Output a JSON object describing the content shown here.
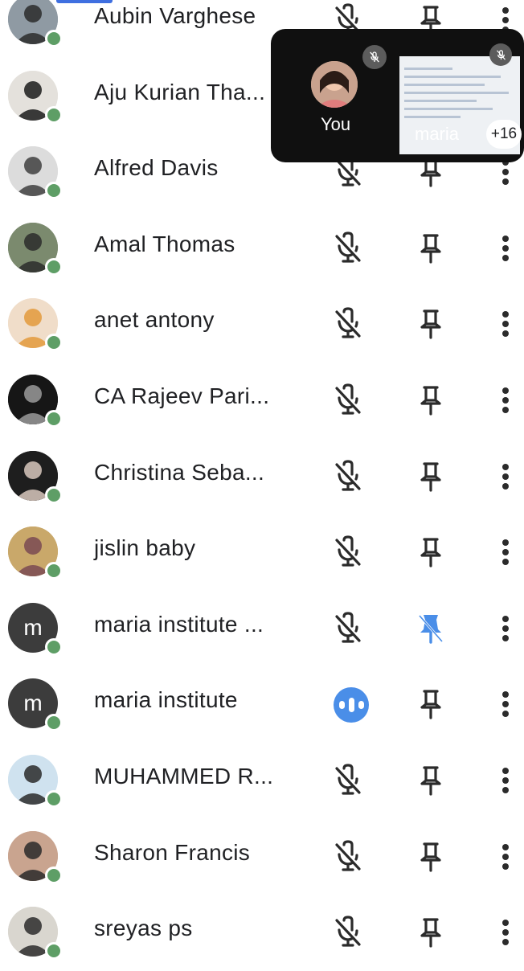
{
  "participants": [
    {
      "name": "Aubin Varghese",
      "mic": "muted",
      "pinned": false,
      "avatar": {
        "type": "photo",
        "bg": "#8f9aa3",
        "fg": "#2b2b2b"
      }
    },
    {
      "name": "Aju Kurian Tha...",
      "mic": "muted",
      "pinned": false,
      "avatar": {
        "type": "photo",
        "bg": "#e4e1dc",
        "fg": "#1b1b1b"
      }
    },
    {
      "name": "Alfred Davis",
      "mic": "muted",
      "pinned": false,
      "avatar": {
        "type": "photo",
        "bg": "#dcdcdc",
        "fg": "#404040"
      }
    },
    {
      "name": "Amal Thomas",
      "mic": "muted",
      "pinned": false,
      "avatar": {
        "type": "photo",
        "bg": "#7b8a6e",
        "fg": "#2b2b2b"
      }
    },
    {
      "name": "anet antony",
      "mic": "muted",
      "pinned": false,
      "avatar": {
        "type": "photo",
        "bg": "#f0ddc9",
        "fg": "#e39a3c"
      }
    },
    {
      "name": "CA Rajeev Pari...",
      "mic": "muted",
      "pinned": false,
      "avatar": {
        "type": "photo",
        "bg": "#161616",
        "fg": "#9a9a9a"
      }
    },
    {
      "name": "Christina Seba...",
      "mic": "muted",
      "pinned": false,
      "avatar": {
        "type": "photo",
        "bg": "#1e1e1e",
        "fg": "#d8c8bd"
      }
    },
    {
      "name": "jislin baby",
      "mic": "muted",
      "pinned": false,
      "avatar": {
        "type": "photo",
        "bg": "#c9a86a",
        "fg": "#7a4a52"
      }
    },
    {
      "name": "maria institute ...",
      "mic": "muted",
      "pinned": true,
      "avatar": {
        "type": "letter",
        "letter": "m",
        "bg": "#3c3c3c"
      }
    },
    {
      "name": "maria institute",
      "mic": "speaking",
      "pinned": false,
      "avatar": {
        "type": "letter",
        "letter": "m",
        "bg": "#3c3c3c"
      }
    },
    {
      "name": "MUHAMMED R...",
      "mic": "muted",
      "pinned": false,
      "avatar": {
        "type": "photo",
        "bg": "#cfe2ef",
        "fg": "#2a2a2a"
      }
    },
    {
      "name": "Sharon Francis",
      "mic": "muted",
      "pinned": false,
      "avatar": {
        "type": "photo",
        "bg": "#c9a48f",
        "fg": "#2a2a2a"
      }
    },
    {
      "name": "sreyas ps",
      "mic": "muted",
      "pinned": false,
      "avatar": {
        "type": "photo",
        "bg": "#d9d6cf",
        "fg": "#2b2b2b"
      }
    }
  ],
  "overlay": {
    "self_label": "You",
    "presenter_label": "maria",
    "extra_count": "+16"
  },
  "colors": {
    "icon": "#2b2b2b",
    "pin_active": "#4a8ee8",
    "speaking": "#4a8ee8",
    "online": "#5e9e66",
    "top_bar": "#3f6fe0"
  },
  "icons": {
    "mic": "mic-off-icon",
    "pin": "pin-icon",
    "pin_active": "pin-active-icon",
    "speaking": "speaking-icon",
    "more": "more-vert-icon"
  }
}
